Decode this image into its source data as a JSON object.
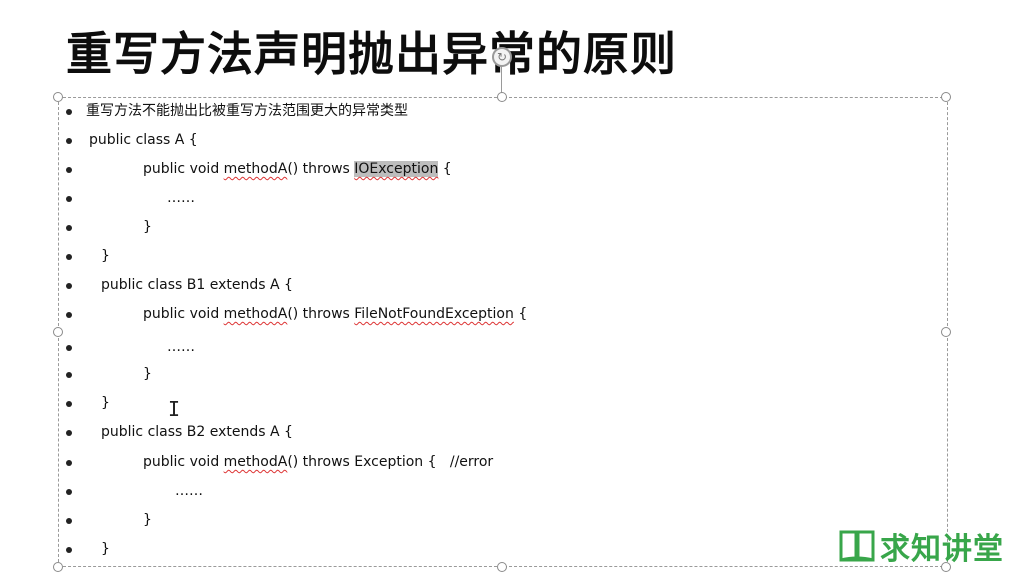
{
  "slide": {
    "title": "重写方法声明抛出异常的原则"
  },
  "content": {
    "line1": "重写方法不能抛出比被重写方法范围更大的异常类型",
    "line2": "public class A {",
    "line3_prefix": "public void ",
    "line3_method": "methodA",
    "line3_mid": "() throws ",
    "line3_exc": "IOException",
    "line3_suffix": " {",
    "line4": "……",
    "line5": "}",
    "line6": "}",
    "line7": "public class B1 extends A {",
    "line8_prefix": "public void ",
    "line8_method": "methodA",
    "line8_mid": "() throws ",
    "line8_exc": "FileNotFoundException",
    "line8_suffix": " {",
    "line9": "……",
    "line10": "}",
    "line11": "}",
    "line12": "public class B2 extends A {",
    "line13_prefix": "public void ",
    "line13_method": "methodA",
    "line13_rest": "() throws Exception {   //error",
    "line14": "……",
    "line15": "}",
    "line16": "}"
  },
  "watermark": {
    "text": "求知讲堂",
    "color": "#38a64a",
    "icon": "open-book-icon"
  },
  "colors": {
    "selection_highlight": "#bdbdbd",
    "spellcheck": "#d33"
  }
}
